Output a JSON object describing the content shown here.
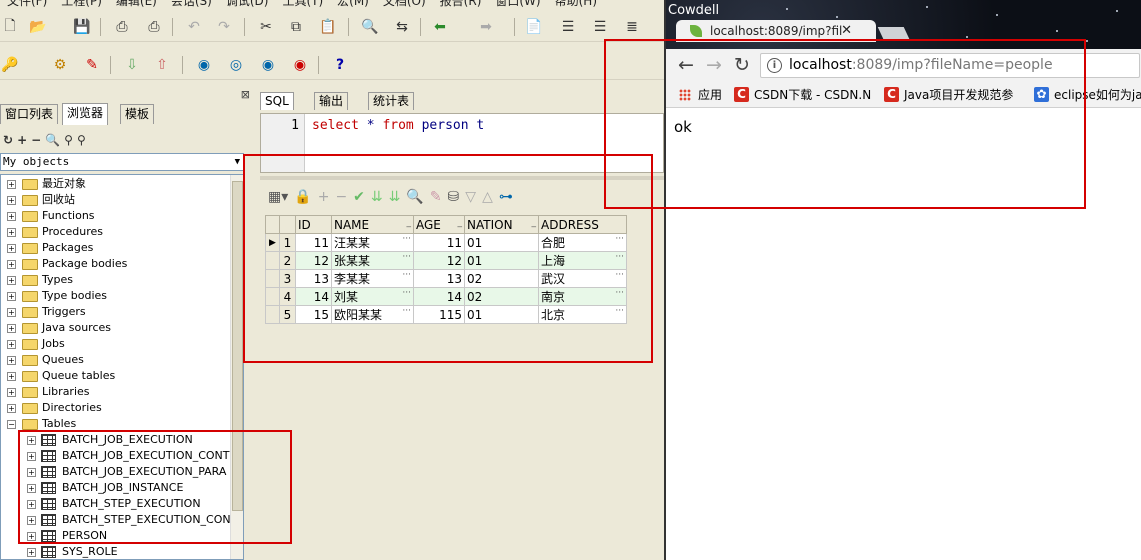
{
  "menu": [
    "文件(F)",
    "工程(P)",
    "编辑(E)",
    "会话(S)",
    "调试(D)",
    "工具(T)",
    "宏(M)",
    "文档(O)",
    "报告(R)",
    "窗口(W)",
    "帮助(H)"
  ],
  "left_panel": {
    "tabs": [
      "窗口列表",
      "浏览器",
      "模板"
    ],
    "filter": "My objects",
    "tree": [
      "最近对象",
      "回收站",
      "Functions",
      "Procedures",
      "Packages",
      "Package bodies",
      "Types",
      "Type bodies",
      "Triggers",
      "Java sources",
      "Jobs",
      "Queues",
      "Queue tables",
      "Libraries",
      "Directories",
      "Tables"
    ],
    "tables": [
      "BATCH_JOB_EXECUTION",
      "BATCH_JOB_EXECUTION_CONT",
      "BATCH_JOB_EXECUTION_PARA",
      "BATCH_JOB_INSTANCE",
      "BATCH_STEP_EXECUTION",
      "BATCH_STEP_EXECUTION_CON",
      "PERSON",
      "SYS_ROLE"
    ]
  },
  "sql_window": {
    "tabs": [
      "SQL",
      "输出",
      "统计表"
    ],
    "line_number": "1",
    "query": {
      "kw1": "select",
      "star": " * ",
      "kw2": "from",
      "rest": " person t"
    },
    "grid": {
      "columns": [
        "ID",
        "NAME",
        "AGE",
        "NATION",
        "ADDRESS"
      ],
      "rows": [
        {
          "n": "1",
          "id": "11",
          "name": "汪某某",
          "age": "11",
          "nation": "01",
          "address": "合肥"
        },
        {
          "n": "2",
          "id": "12",
          "name": "张某某",
          "age": "12",
          "nation": "01",
          "address": "上海"
        },
        {
          "n": "3",
          "id": "13",
          "name": "李某某",
          "age": "13",
          "nation": "02",
          "address": "武汉"
        },
        {
          "n": "4",
          "id": "14",
          "name": "刘某",
          "age": "14",
          "nation": "02",
          "address": "南京"
        },
        {
          "n": "5",
          "id": "15",
          "name": "欧阳某某",
          "age": "115",
          "nation": "01",
          "address": "北京"
        }
      ]
    }
  },
  "browser": {
    "window_title": "Cowdell",
    "tab_title": "localhost:8089/imp?fil",
    "url_host": "localhost",
    "url_rest": ":8089/imp?fileName=people",
    "bookmarks": [
      "应用",
      "CSDN下载 - CSDN.N",
      "Java项目开发规范参",
      "eclipse如何为jav"
    ],
    "content": "ok"
  },
  "colors": {
    "annotation_red": "#d40000",
    "keyword": "#c00000",
    "alt_row": "#e8f8e8"
  }
}
